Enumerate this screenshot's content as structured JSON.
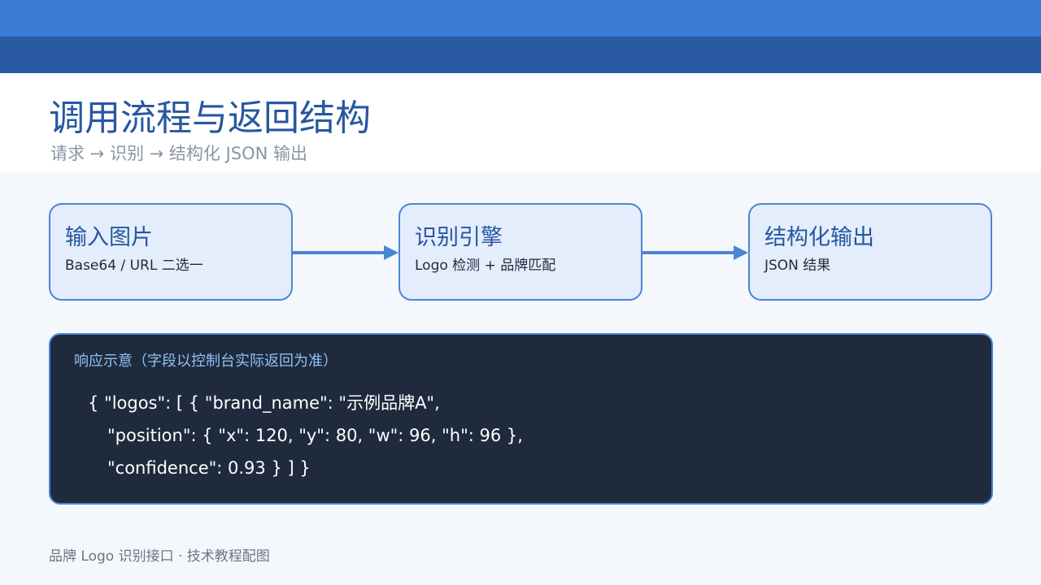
{
  "header": {
    "title": "调用流程与返回结构",
    "subtitle": "请求 → 识别 → 结构化 JSON 输出"
  },
  "flow": {
    "stages": [
      {
        "title": "输入图片",
        "description": "Base64 / URL 二选一"
      },
      {
        "title": "识别引擎",
        "description": "Logo 检测 + 品牌匹配"
      },
      {
        "title": "结构化输出",
        "description": "JSON 结果"
      }
    ]
  },
  "response": {
    "caption": "响应示意（字段以控制台实际返回为准）",
    "lines": [
      "{ \"logos\": [ { \"brand_name\": \"示例品牌A\",",
      "\"position\": { \"x\": 120, \"y\": 80, \"w\": 96, \"h\": 96 },",
      "\"confidence\": 0.93 } ] }"
    ]
  },
  "footer": {
    "text": "品牌 Logo 识别接口 · 技术教程配图"
  },
  "colors": {
    "band_light": "#3a7bd5",
    "band_dark": "#2a5aa2",
    "title": "#2757a0",
    "stage_fill": "#e3edfb",
    "stage_border": "#4a86d6",
    "code_bg": "#1f2a3d",
    "code_caption": "#8fc0f2"
  }
}
